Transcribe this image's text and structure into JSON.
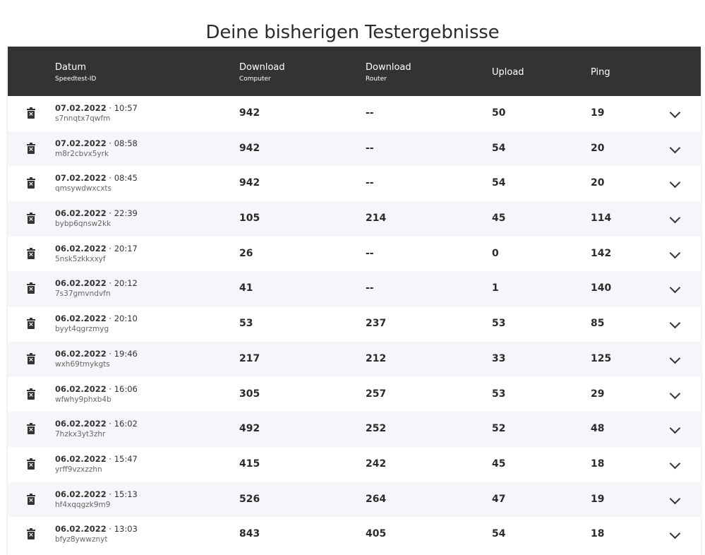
{
  "title": "Deine bisherigen Testergebnisse",
  "columns": {
    "date": "Datum",
    "date_sub": "Speedtest-ID",
    "download_computer": "Download",
    "download_computer_sub": "Computer",
    "download_router": "Download",
    "download_router_sub": "Router",
    "upload": "Upload",
    "ping": "Ping"
  },
  "icons": {
    "delete": "trash-icon",
    "expand": "chevron-down-icon"
  },
  "rows": [
    {
      "date": "07.02.2022",
      "time": "10:57",
      "id": "s7nnqtx7qwfm",
      "dl_computer": "942",
      "dl_router": "--",
      "upload": "50",
      "ping": "19"
    },
    {
      "date": "07.02.2022",
      "time": "08:58",
      "id": "m8r2cbvx5yrk",
      "dl_computer": "942",
      "dl_router": "--",
      "upload": "54",
      "ping": "20"
    },
    {
      "date": "07.02.2022",
      "time": "08:45",
      "id": "qmsywdwxcxts",
      "dl_computer": "942",
      "dl_router": "--",
      "upload": "54",
      "ping": "20"
    },
    {
      "date": "06.02.2022",
      "time": "22:39",
      "id": "bybp6qnsw2kk",
      "dl_computer": "105",
      "dl_router": "214",
      "upload": "45",
      "ping": "114"
    },
    {
      "date": "06.02.2022",
      "time": "20:17",
      "id": "5nsk5zkkxxyf",
      "dl_computer": "26",
      "dl_router": "--",
      "upload": "0",
      "ping": "142"
    },
    {
      "date": "06.02.2022",
      "time": "20:12",
      "id": "7s37gmvndvfn",
      "dl_computer": "41",
      "dl_router": "--",
      "upload": "1",
      "ping": "140"
    },
    {
      "date": "06.02.2022",
      "time": "20:10",
      "id": "byyt4qgrzmyg",
      "dl_computer": "53",
      "dl_router": "237",
      "upload": "53",
      "ping": "85"
    },
    {
      "date": "06.02.2022",
      "time": "19:46",
      "id": "wxh69tmykgts",
      "dl_computer": "217",
      "dl_router": "212",
      "upload": "33",
      "ping": "125"
    },
    {
      "date": "06.02.2022",
      "time": "16:06",
      "id": "wfwhy9phxb4b",
      "dl_computer": "305",
      "dl_router": "257",
      "upload": "53",
      "ping": "29"
    },
    {
      "date": "06.02.2022",
      "time": "16:02",
      "id": "7hzkx3yt3zhr",
      "dl_computer": "492",
      "dl_router": "252",
      "upload": "52",
      "ping": "48"
    },
    {
      "date": "06.02.2022",
      "time": "15:47",
      "id": "yrff9vzxzzhn",
      "dl_computer": "415",
      "dl_router": "242",
      "upload": "45",
      "ping": "18"
    },
    {
      "date": "06.02.2022",
      "time": "15:13",
      "id": "hf4xqqgzk9m9",
      "dl_computer": "526",
      "dl_router": "264",
      "upload": "47",
      "ping": "19"
    },
    {
      "date": "06.02.2022",
      "time": "13:03",
      "id": "bfyz8ywwznyt",
      "dl_computer": "843",
      "dl_router": "405",
      "upload": "54",
      "ping": "18"
    }
  ]
}
